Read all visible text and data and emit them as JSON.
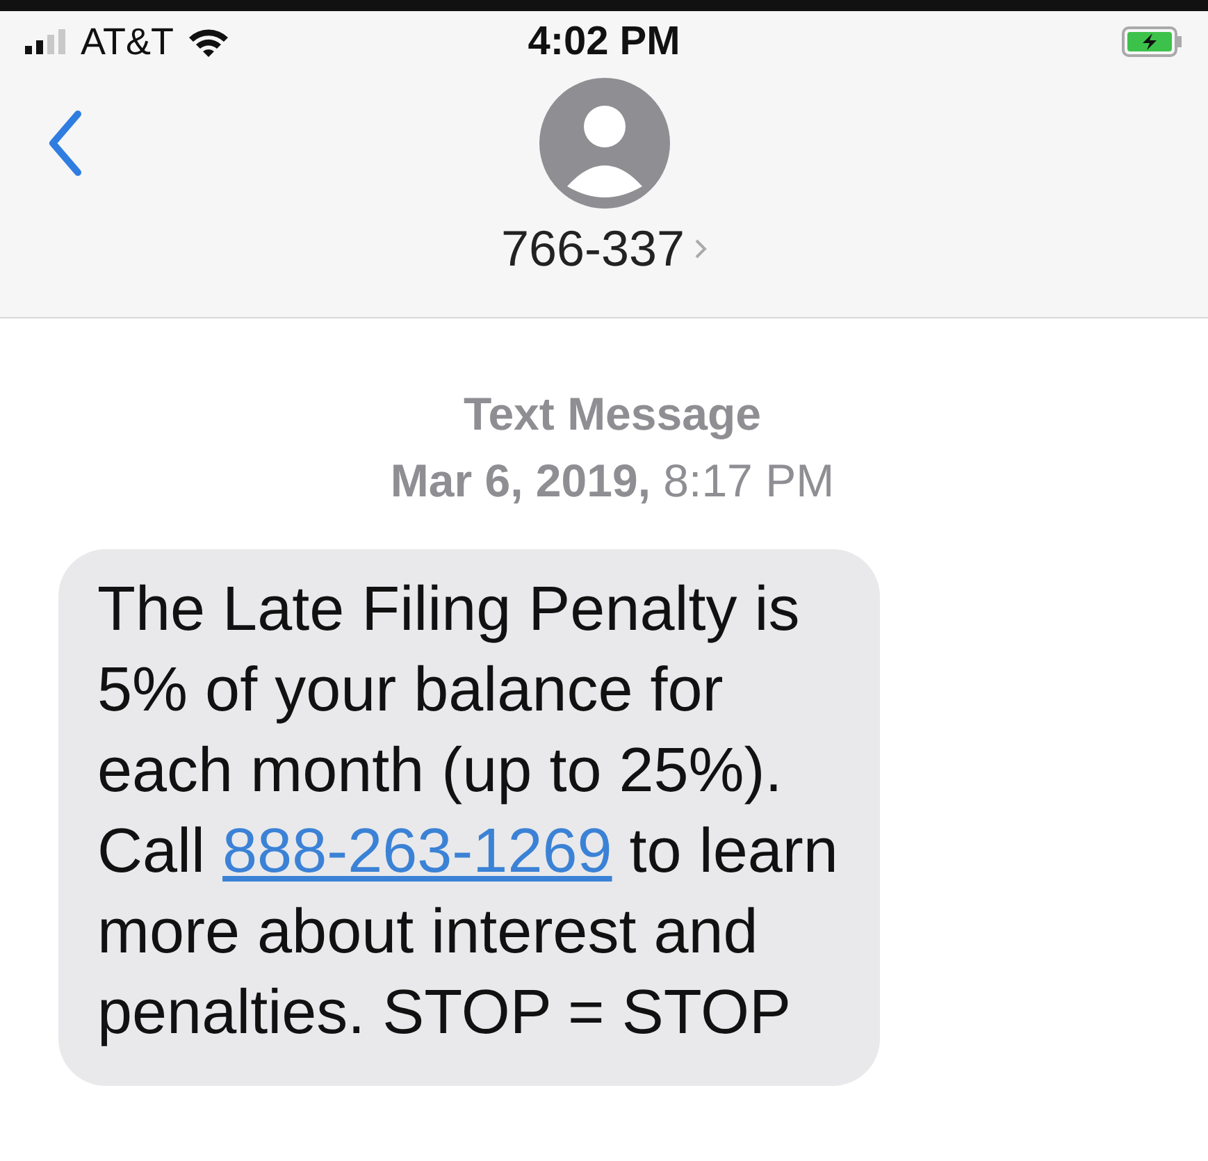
{
  "status_bar": {
    "carrier": "AT&T",
    "time": "4:02 PM"
  },
  "header": {
    "contact": "766-337"
  },
  "timestamp": {
    "label": "Text Message",
    "date": "**Mar 6, 2019,** 8:17 PM"
  },
  "messages": [
    {
      "text_before": "The Late Filing Penalty is 5% of your balance for each month (up to 25%). Call ",
      "link": "888-263-1269",
      "text_after": " to learn more about interest and penalties. STOP = STOP"
    }
  ]
}
